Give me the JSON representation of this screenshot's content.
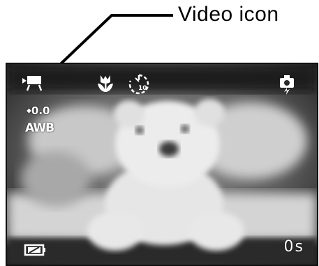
{
  "callout": {
    "label": "Video icon"
  },
  "osd": {
    "mode_icon": "video-camera-icon",
    "macro_icon": "macro-flower-icon",
    "self_timer_icon": "self-timer-icon",
    "self_timer_value": "10",
    "flash_icon": "flash-icon",
    "exposure": "0.0",
    "white_balance": "AWB",
    "battery_icon": "battery-icon",
    "recording_time": "0s"
  },
  "colors": {
    "osd_text": "#ffffff",
    "lcd_background": "#2a2a2a"
  }
}
